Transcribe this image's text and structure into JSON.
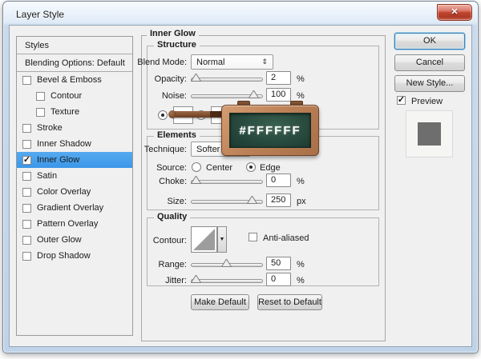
{
  "window": {
    "title": "Layer Style"
  },
  "icons": {
    "close": "✕",
    "updown": "⇕",
    "down_arrow": "▼",
    "check": "✓"
  },
  "sidebar": {
    "header": "Styles",
    "blending_row": "Blending Options: Default",
    "items": [
      {
        "label": "Bevel & Emboss",
        "checked": false,
        "indent": false,
        "selected": false
      },
      {
        "label": "Contour",
        "checked": false,
        "indent": true,
        "selected": false
      },
      {
        "label": "Texture",
        "checked": false,
        "indent": true,
        "selected": false
      },
      {
        "label": "Stroke",
        "checked": false,
        "indent": false,
        "selected": false
      },
      {
        "label": "Inner Shadow",
        "checked": false,
        "indent": false,
        "selected": false
      },
      {
        "label": "Inner Glow",
        "checked": true,
        "indent": false,
        "selected": true
      },
      {
        "label": "Satin",
        "checked": false,
        "indent": false,
        "selected": false
      },
      {
        "label": "Color Overlay",
        "checked": false,
        "indent": false,
        "selected": false
      },
      {
        "label": "Gradient Overlay",
        "checked": false,
        "indent": false,
        "selected": false
      },
      {
        "label": "Pattern Overlay",
        "checked": false,
        "indent": false,
        "selected": false
      },
      {
        "label": "Outer Glow",
        "checked": false,
        "indent": false,
        "selected": false
      },
      {
        "label": "Drop Shadow",
        "checked": false,
        "indent": false,
        "selected": false
      }
    ]
  },
  "main": {
    "title": "Inner Glow",
    "structure": {
      "legend": "Structure",
      "blend_mode_label": "Blend Mode:",
      "blend_mode_value": "Normal",
      "opacity_label": "Opacity:",
      "opacity_value": "2",
      "opacity_unit": "%",
      "noise_label": "Noise:",
      "noise_value": "100",
      "noise_unit": "%"
    },
    "elements": {
      "legend": "Elements",
      "technique_label": "Technique:",
      "technique_value": "Softer",
      "source_label": "Source:",
      "source_center_label": "Center",
      "source_edge_label": "Edge",
      "choke_label": "Choke:",
      "choke_value": "0",
      "choke_unit": "%",
      "size_label": "Size:",
      "size_value": "250",
      "size_unit": "px"
    },
    "quality": {
      "legend": "Quality",
      "contour_label": "Contour:",
      "antialiased_label": "Anti-aliased",
      "range_label": "Range:",
      "range_value": "50",
      "range_unit": "%",
      "jitter_label": "Jitter:",
      "jitter_value": "0",
      "jitter_unit": "%"
    },
    "footer_buttons": {
      "make_default": "Make Default",
      "reset_default": "Reset to Default"
    }
  },
  "actions": {
    "ok": "OK",
    "cancel": "Cancel",
    "new_style": "New Style...",
    "preview_label": "Preview"
  },
  "overlay": {
    "hex_value": "#FFFFFF"
  },
  "colors": {
    "selection_blue": "#3c97e8",
    "board_green": "#24443a",
    "wood_brown": "#bd8258",
    "glow_color": "#ffffff",
    "preview_square_gray": "#6e6e6e"
  }
}
